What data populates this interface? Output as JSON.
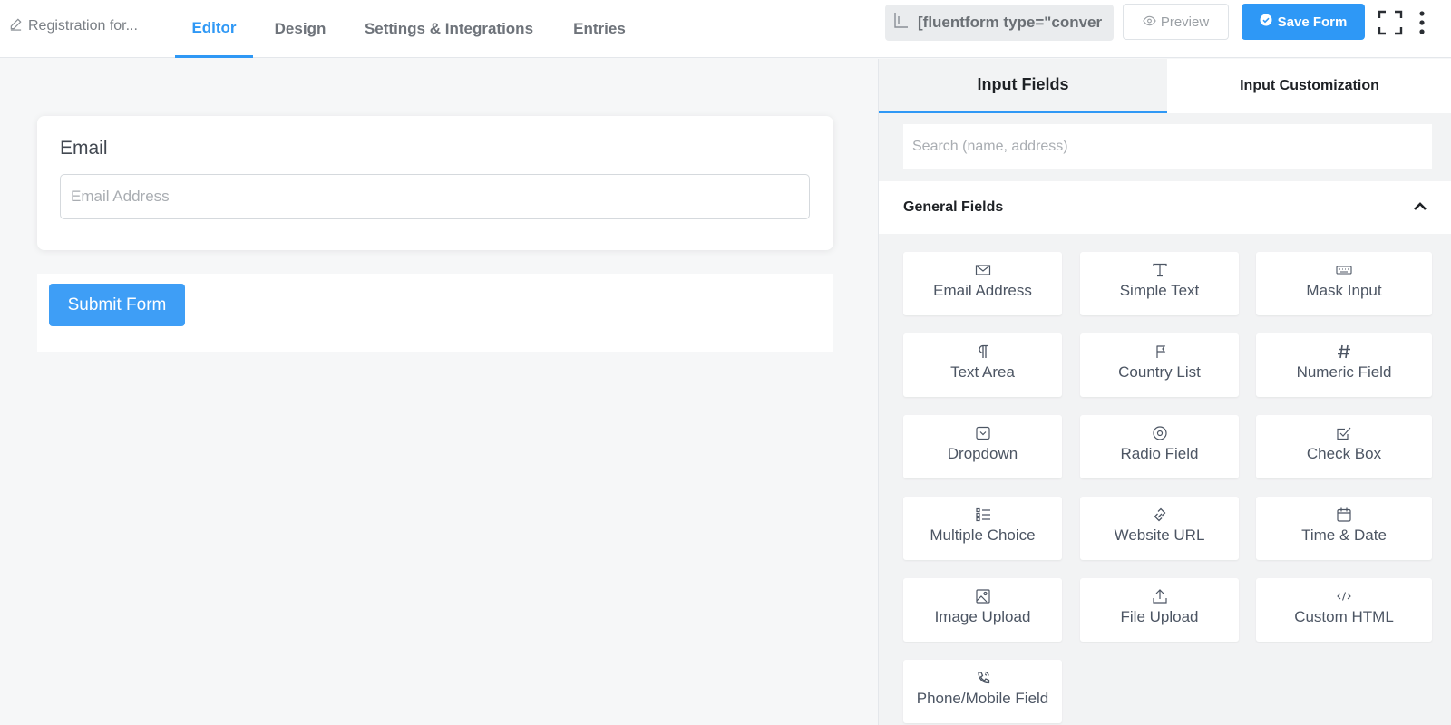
{
  "header": {
    "form_name": "Registration for...",
    "tabs": [
      "Editor",
      "Design",
      "Settings & Integrations",
      "Entries"
    ],
    "active_tab": "Editor",
    "shortcode": "[fluentform type=\"conver",
    "preview_label": "Preview",
    "save_label": "Save Form"
  },
  "editor": {
    "field_label": "Email",
    "email_placeholder": "Email Address",
    "submit_label": "Submit Form"
  },
  "sidebar": {
    "tabs": [
      "Input Fields",
      "Input Customization"
    ],
    "active_tab": "Input Fields",
    "search_placeholder": "Search (name, address)",
    "section_title": "General Fields",
    "fields": [
      {
        "label": "Email Address",
        "icon": "envelope-icon"
      },
      {
        "label": "Simple Text",
        "icon": "text-cursor-icon"
      },
      {
        "label": "Mask Input",
        "icon": "keyboard-icon"
      },
      {
        "label": "Text Area",
        "icon": "paragraph-icon"
      },
      {
        "label": "Country List",
        "icon": "flag-icon"
      },
      {
        "label": "Numeric Field",
        "icon": "hash-icon"
      },
      {
        "label": "Dropdown",
        "icon": "dropdown-icon"
      },
      {
        "label": "Radio Field",
        "icon": "radio-icon"
      },
      {
        "label": "Check Box",
        "icon": "checkbox-icon"
      },
      {
        "label": "Multiple Choice",
        "icon": "list-icon"
      },
      {
        "label": "Website URL",
        "icon": "link-icon"
      },
      {
        "label": "Time & Date",
        "icon": "calendar-icon"
      },
      {
        "label": "Image Upload",
        "icon": "image-icon"
      },
      {
        "label": "File Upload",
        "icon": "upload-icon"
      },
      {
        "label": "Custom HTML",
        "icon": "code-icon"
      },
      {
        "label": "Phone/Mobile Field",
        "icon": "phone-icon"
      }
    ]
  },
  "colors": {
    "accent": "#2e98f6",
    "submit_button": "#3e9ef6",
    "label_text": "#4c5563"
  }
}
